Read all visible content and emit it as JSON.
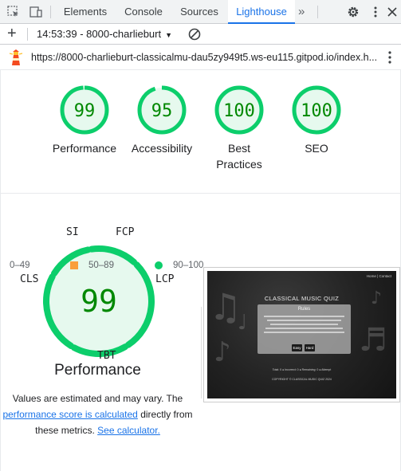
{
  "tabs": {
    "items": [
      "Elements",
      "Console",
      "Sources",
      "Lighthouse"
    ],
    "active": "Lighthouse",
    "more": "»"
  },
  "toolbar": {
    "add": "+",
    "report": "14:53:39 - 8000-charlieburt",
    "caret": "▼"
  },
  "urlbar": {
    "url": "https://8000-charlieburt-classicalmu-dau5zy949t5.ws-eu115.gitpod.io/index.h..."
  },
  "scores": [
    {
      "value": "99",
      "score": 0.99,
      "label": "Performance"
    },
    {
      "value": "95",
      "score": 0.95,
      "label": "Accessibility"
    },
    {
      "value": "100",
      "score": 1.0,
      "label": "Best Practices"
    },
    {
      "value": "100",
      "score": 1.0,
      "label": "SEO"
    }
  ],
  "performance": {
    "score": "99",
    "title": "Performance",
    "metrics": [
      "SI",
      "FCP",
      "LCP",
      "TBT",
      "CLS"
    ],
    "note_pre": "Values are estimated and may vary. The",
    "note_link1": "performance score is calculated",
    "note_mid": "directly from these metrics.",
    "note_link2": "See calculator."
  },
  "screenshot": {
    "nav": "Home | Contact",
    "title": "CLASSICAL MUSIC QUIZ",
    "card_title": "Rules",
    "btn_easy": "Easy",
    "btn_hard": "Hard",
    "legend": "Total: 0   ●  Incorrect: 0   ●  Remaining: 0   ●  Attempt",
    "copyright": "COPYRIGHT © CLASSICAL MUSIC QUIZ 2024"
  },
  "legend": {
    "low": "0–49",
    "mid": "50–89",
    "high": "90–100"
  },
  "colors": {
    "pass": "#0cce6b",
    "pass_text": "#008800",
    "pass_bg": "#e6f9ee",
    "average": "#fa9f3b",
    "fail": "#ff4e42",
    "link": "#1a73e8"
  }
}
